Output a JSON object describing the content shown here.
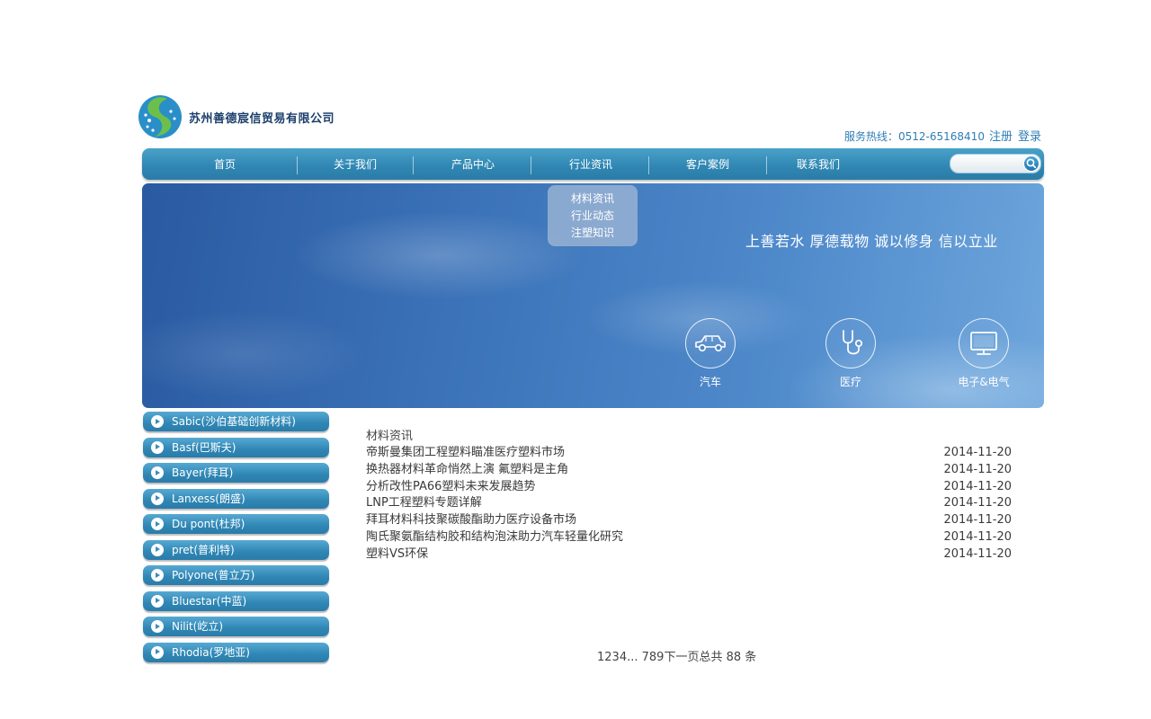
{
  "header": {
    "company_name": "苏州善德宸信贸易有限公司",
    "hotline": "服务热线：0512-65168410",
    "register_label": "注册",
    "login_label": "登录"
  },
  "nav": {
    "items": [
      "首页",
      "关于我们",
      "产品中心",
      "行业资讯",
      "客户案例",
      "联系我们"
    ],
    "search_placeholder": ""
  },
  "dropdown": {
    "items": [
      "材料资讯",
      "行业动态",
      "注塑知识"
    ]
  },
  "banner": {
    "slogan": "上善若水 厚德载物 诚以修身 信以立业",
    "categories": [
      {
        "label": "汽车",
        "icon": "car-icon"
      },
      {
        "label": "医疗",
        "icon": "stethoscope-icon"
      },
      {
        "label": "电子&电气",
        "icon": "monitor-icon"
      }
    ]
  },
  "brands": [
    "Sabic(沙伯基础创新材料)",
    "Basf(巴斯夫)",
    "Bayer(拜耳)",
    "Lanxess(朗盛)",
    "Du pont(杜邦)",
    "pret(普利特)",
    "Polyone(普立万)",
    "Bluestar(中蓝)",
    "Nilit(屹立)",
    "Rhodia(罗地亚)"
  ],
  "news": {
    "section_title": "材料资讯",
    "items": [
      {
        "title": "帝斯曼集团工程塑料瞄准医疗塑料市场",
        "date": "2014-11-20"
      },
      {
        "title": "换热器材料革命悄然上演 氟塑料是主角",
        "date": "2014-11-20"
      },
      {
        "title": "分析改性PA66塑料未来发展趋势",
        "date": "2014-11-20"
      },
      {
        "title": "LNP工程塑料专题详解",
        "date": "2014-11-20"
      },
      {
        "title": "拜耳材料科技聚碳酸酯助力医疗设备市场",
        "date": "2014-11-20"
      },
      {
        "title": "陶氏聚氨酯结构胶和结构泡沫助力汽车轻量化研究",
        "date": "2014-11-20"
      },
      {
        "title": "塑料VS环保",
        "date": "2014-11-20"
      }
    ]
  },
  "pagination": {
    "pages": "1234... 789",
    "next": "下一页",
    "total": "总共 88 条"
  },
  "colors": {
    "nav_blue": "#2f86b2",
    "text_blue": "#2f7db5",
    "logo_green": "#5fb84a"
  }
}
